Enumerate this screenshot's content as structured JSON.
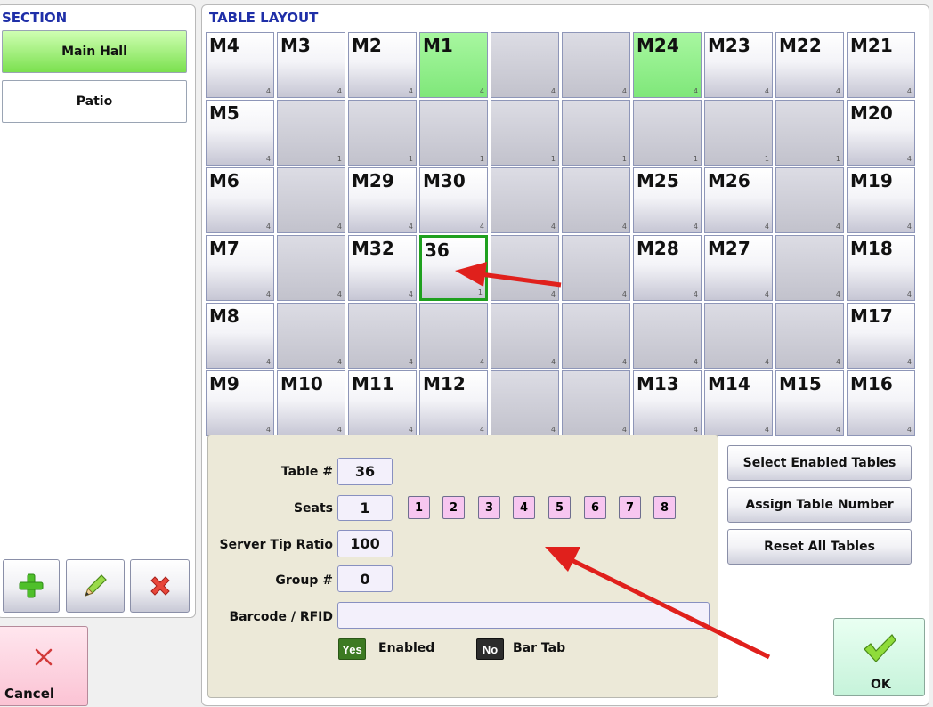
{
  "section": {
    "header": "SECTION",
    "items": [
      {
        "label": "Main Hall",
        "active": true
      },
      {
        "label": "Patio",
        "active": false
      }
    ],
    "toolbar": {
      "add_icon": "plus-icon",
      "edit_icon": "pencil-icon",
      "delete_icon": "x-icon"
    }
  },
  "layout": {
    "header": "TABLE LAYOUT",
    "rows": [
      [
        {
          "n": "M4",
          "c": "4"
        },
        {
          "n": "M3",
          "c": "4"
        },
        {
          "n": "M2",
          "c": "4"
        },
        {
          "n": "M1",
          "c": "4",
          "s": "green"
        },
        {
          "n": "",
          "c": "4"
        },
        {
          "n": "",
          "c": "4"
        },
        {
          "n": "M24",
          "c": "4",
          "s": "green"
        },
        {
          "n": "M23",
          "c": "4"
        },
        {
          "n": "M22",
          "c": "4"
        },
        {
          "n": "M21",
          "c": "4"
        }
      ],
      [
        {
          "n": "M5",
          "c": "4"
        },
        {
          "n": "",
          "c": "1"
        },
        {
          "n": "",
          "c": "1"
        },
        {
          "n": "",
          "c": "1"
        },
        {
          "n": "",
          "c": "1"
        },
        {
          "n": "",
          "c": "1"
        },
        {
          "n": "",
          "c": "1"
        },
        {
          "n": "",
          "c": "1"
        },
        {
          "n": "",
          "c": "1"
        },
        {
          "n": "M20",
          "c": "4"
        }
      ],
      [
        {
          "n": "M6",
          "c": "4"
        },
        {
          "n": "",
          "c": "4"
        },
        {
          "n": "M29",
          "c": "4"
        },
        {
          "n": "M30",
          "c": "4"
        },
        {
          "n": "",
          "c": "4"
        },
        {
          "n": "",
          "c": "4"
        },
        {
          "n": "M25",
          "c": "4"
        },
        {
          "n": "M26",
          "c": "4"
        },
        {
          "n": "",
          "c": "4"
        },
        {
          "n": "M19",
          "c": "4"
        }
      ],
      [
        {
          "n": "M7",
          "c": "4"
        },
        {
          "n": "",
          "c": "4"
        },
        {
          "n": "M32",
          "c": "4"
        },
        {
          "n": "36",
          "c": "1",
          "s": "selected"
        },
        {
          "n": "",
          "c": "4"
        },
        {
          "n": "",
          "c": "4"
        },
        {
          "n": "M28",
          "c": "4"
        },
        {
          "n": "M27",
          "c": "4"
        },
        {
          "n": "",
          "c": "4"
        },
        {
          "n": "M18",
          "c": "4"
        }
      ],
      [
        {
          "n": "M8",
          "c": "4"
        },
        {
          "n": "",
          "c": "4"
        },
        {
          "n": "",
          "c": "4"
        },
        {
          "n": "",
          "c": "4"
        },
        {
          "n": "",
          "c": "4"
        },
        {
          "n": "",
          "c": "4"
        },
        {
          "n": "",
          "c": "4"
        },
        {
          "n": "",
          "c": "4"
        },
        {
          "n": "",
          "c": "4"
        },
        {
          "n": "M17",
          "c": "4"
        }
      ],
      [
        {
          "n": "M9",
          "c": "4"
        },
        {
          "n": "M10",
          "c": "4"
        },
        {
          "n": "M11",
          "c": "4"
        },
        {
          "n": "M12",
          "c": "4"
        },
        {
          "n": "",
          "c": "4"
        },
        {
          "n": "",
          "c": "4"
        },
        {
          "n": "M13",
          "c": "4"
        },
        {
          "n": "M14",
          "c": "4"
        },
        {
          "n": "M15",
          "c": "4"
        },
        {
          "n": "M16",
          "c": "4"
        }
      ]
    ]
  },
  "form": {
    "table_label": "Table #",
    "table_value": "36",
    "seats_label": "Seats",
    "seats_value": "1",
    "seat_options": [
      "1",
      "2",
      "3",
      "4",
      "5",
      "6",
      "7",
      "8"
    ],
    "tip_label": "Server Tip Ratio",
    "tip_value": "100",
    "group_label": "Group #",
    "group_value": "0",
    "barcode_label": "Barcode / RFID",
    "barcode_value": "",
    "enabled_toggle": "Yes",
    "enabled_label": "Enabled",
    "bartab_toggle": "No",
    "bartab_label": "Bar Tab"
  },
  "actions": {
    "select_enabled": "Select Enabled Tables",
    "assign_number": "Assign Table Number",
    "reset_all": "Reset All Tables",
    "cancel": "Cancel",
    "ok": "OK"
  },
  "colors": {
    "header_blue": "#1f2fa8",
    "active_green": "#7be04f",
    "selected_border": "#1fa01f",
    "arrow_red": "#e0201c",
    "seat_pink": "#f7c6f0"
  }
}
